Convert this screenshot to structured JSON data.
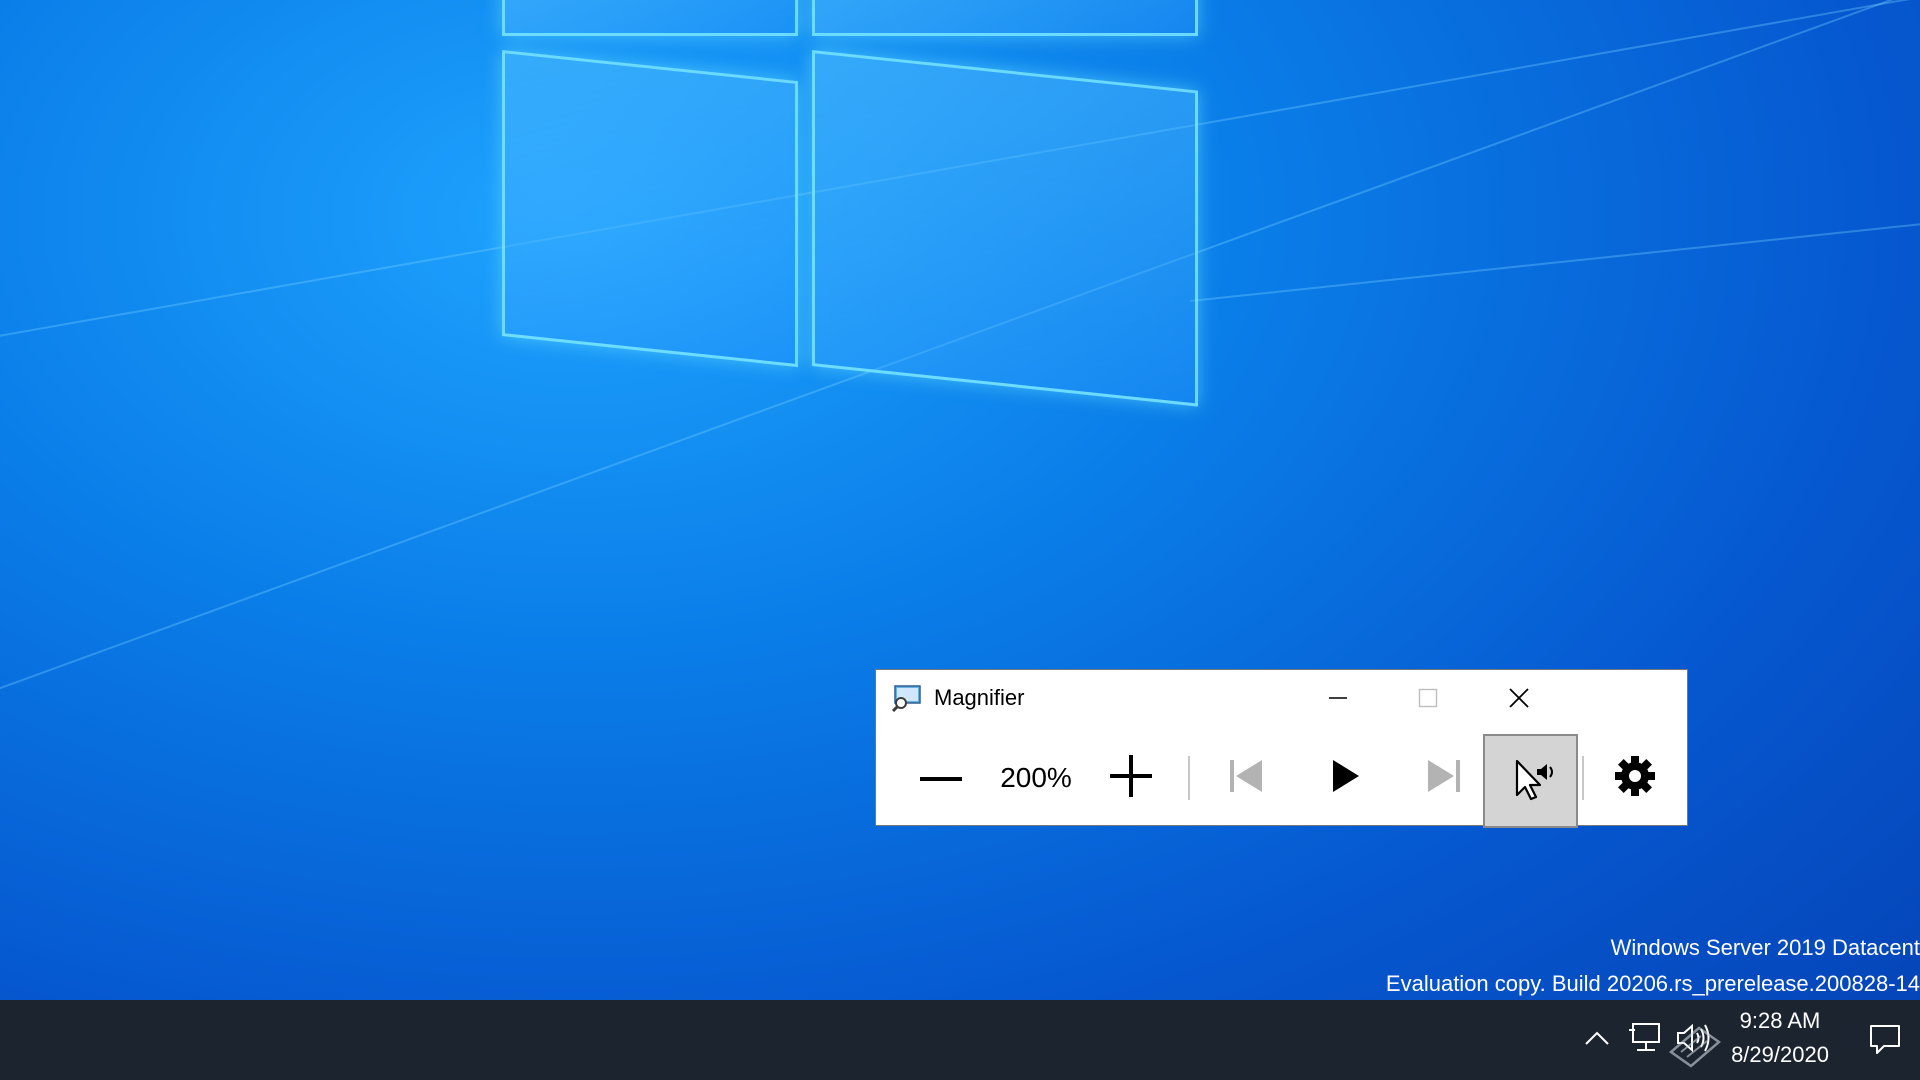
{
  "desktop": {
    "watermark_line1": "Windows Server 2019 Datacent",
    "watermark_line2": "Evaluation copy. Build 20206.rs_prerelease.200828-14"
  },
  "magnifier": {
    "title": "Magnifier",
    "app_icon": "magnifier-app-icon",
    "minimize_icon": "minimize-icon",
    "maximize_icon": "maximize-icon",
    "close_icon": "close-icon",
    "zoom_out_icon": "minus-icon",
    "zoom_level": "200%",
    "zoom_in_icon": "plus-icon",
    "previous_icon": "skip-previous-icon",
    "play_icon": "play-icon",
    "next_icon": "skip-next-icon",
    "read_from_here_icon": "read-from-here-icon",
    "settings_icon": "gear-icon"
  },
  "taskbar": {
    "tray_icons": [
      "chevron-up-icon",
      "network-icon",
      "volume-icon",
      "keyboard-icon"
    ],
    "time": "9:28 AM",
    "date": "8/29/2020",
    "notifications_icon": "action-center-icon"
  },
  "colors": {
    "desktop_blue": "#0a7ee8",
    "taskbar": "#1c2430",
    "window_bg": "#ffffff",
    "active_button_bg": "#d4d4d4"
  }
}
